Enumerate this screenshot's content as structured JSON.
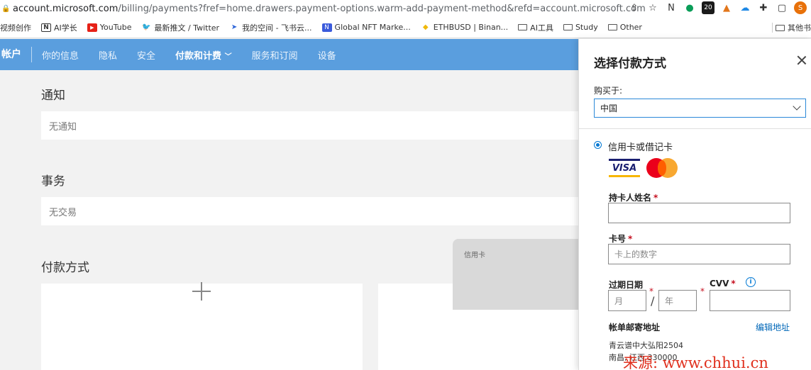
{
  "browser": {
    "url_host": "account.microsoft.com",
    "url_path": "/billing/payments?fref=home.drawers.payment-options.warm-add-payment-method&refd=account.microsoft.com",
    "extension_badge": "20",
    "profile_initial": "S"
  },
  "bookmarks": [
    {
      "label": "视频创作",
      "icon": "none"
    },
    {
      "label": "AI学长",
      "icon": "notion-icon"
    },
    {
      "label": "YouTube",
      "icon": "youtube-icon"
    },
    {
      "label": "最新推文 / Twitter",
      "icon": "twitter-icon"
    },
    {
      "label": "我的空间 - 飞书云...",
      "icon": "feishu-icon"
    },
    {
      "label": "Global NFT Marke...",
      "icon": "nft-icon"
    },
    {
      "label": "ETHBUSD | Binan...",
      "icon": "binance-icon"
    },
    {
      "label": "AI工具",
      "icon": "folder-icon"
    },
    {
      "label": "Study",
      "icon": "folder-icon"
    },
    {
      "label": "Other",
      "icon": "folder-icon"
    }
  ],
  "bookmarks_right": "其他书",
  "ms_nav": {
    "brand": "帐户",
    "items": [
      "你的信息",
      "隐私",
      "安全",
      "付款和计费",
      "服务和订阅",
      "设备"
    ],
    "active_index": 3
  },
  "main": {
    "notifications_title": "通知",
    "notifications_empty": "无通知",
    "transactions_title": "事务",
    "transactions_empty": "无交易",
    "payment_methods_title": "付款方式",
    "credit_card_label": "信用卡"
  },
  "panel": {
    "title": "选择付款方式",
    "purchase_for_label": "购买于:",
    "country_value": "中国",
    "payment_option_label": "信用卡或借记卡",
    "visa_text": "VISA",
    "cardholder_label": "持卡人姓名",
    "card_number_label": "卡号",
    "card_number_placeholder": "卡上的数字",
    "expiry_label": "过期日期",
    "month_placeholder": "月",
    "year_placeholder": "年",
    "cvv_label": "CVV",
    "required_mark": "*",
    "billing_address_label": "帐单邮寄地址",
    "edit_address_link": "编辑地址",
    "address_line1": "青云谱中大弘阳2504",
    "address_line2": "南昌, 江西 330000"
  },
  "watermark": "来源: www.chhui.cn",
  "colors": {
    "nav_blue": "#5a9ede",
    "link_blue": "#0067b8",
    "focus_blue": "#2b88d8",
    "required_red": "#c50f1f"
  }
}
